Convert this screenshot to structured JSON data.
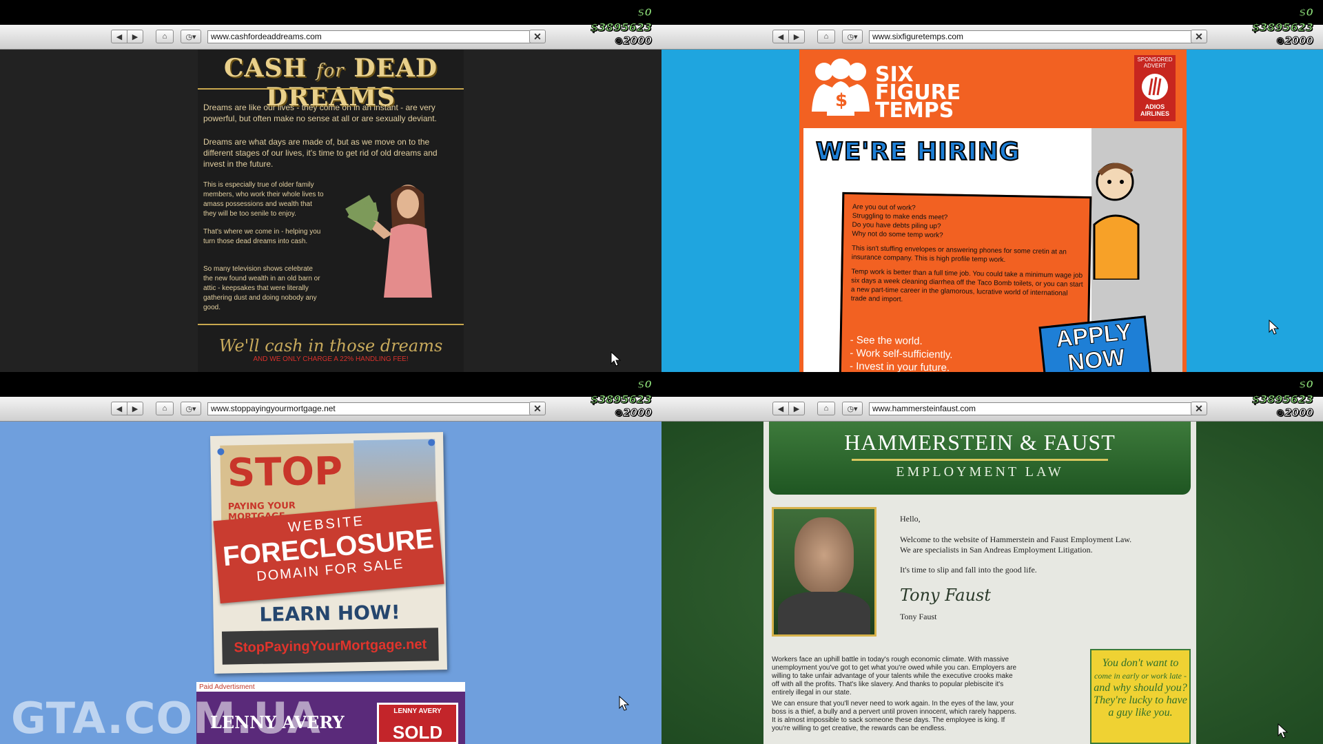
{
  "hud": {
    "cash": "$0",
    "bank": "$3895623",
    "rp": "2000"
  },
  "icons": {
    "back": "back-arrow-icon",
    "forward": "forward-arrow-icon",
    "home": "home-icon",
    "history": "history-clock-icon",
    "close": "close-icon",
    "cursor": "mouse-cursor-icon"
  },
  "toolbar": {
    "back": "◀",
    "forward": "▶",
    "home": "⌂",
    "history": "◷▾",
    "close": "✕"
  },
  "watermark": "GTA.COM.UA",
  "q1": {
    "url": "www.cashfordeaddreams.com",
    "logo_a": "CASH",
    "logo_for": "for",
    "logo_b": "DEAD DREAMS",
    "p1": "Dreams are like our lives - they come on in an instant - are very powerful, but often make no sense at all or are sexually deviant.",
    "p2": "Dreams are what days are made of, but as we move on to the different stages of our lives, it's time to get rid of old dreams and invest in the future.",
    "s1": "This is especially true of older family members, who work their whole lives to amass possessions and wealth that they will be too senile to enjoy.",
    "s2": "That's where we come in - helping you turn those dead dreams into cash.",
    "s3": "So many television shows celebrate the new found wealth in an old barn or attic - keepsakes that were literally gathering dust and doing nobody any good.",
    "slogan": "We'll cash in those dreams",
    "fee": "AND WE ONLY CHARGE A 22% HANDLING FEE!"
  },
  "q2": {
    "url": "www.sixfiguretemps.com",
    "logo": "SIX FIGURE TEMPS",
    "ad_label": "SPONSORED ADVERT",
    "ad_brand": "ADIOS AIRLINES",
    "hiring": "WE'RE HIRING",
    "t1": "Are you out of work?",
    "t2": "Struggling to make ends meet?",
    "t3": "Do you have debts piling up?",
    "t4": "Why not do some temp work?",
    "t5": "This isn't stuffing envelopes or answering phones for some cretin at an insurance company. This is high profile temp work.",
    "t6": "Temp work is better than a full time job. You could take a minimum wage job six days a week cleaning diarrhea off the Taco Bomb toilets, or you can start a new part-time career in the glamorous, lucrative world of international trade and import.",
    "b1": "- See the world.",
    "b2": "- Work self-sufficiently.",
    "b3": "- Invest in your future.",
    "apply": "APPLY NOW"
  },
  "q3": {
    "url": "www.stoppayingyourmortgage.net",
    "stop": "STOP",
    "stop_sub": "PAYING YOUR MORTGAGE",
    "banner1": "WEBSITE",
    "banner2": "FORECLOSURE",
    "banner3": "DOMAIN FOR SALE",
    "learn": "LEARN HOW!",
    "site": "StopPayingYourMortgage.net",
    "ad_label": "Paid Advertisment",
    "ad_name": "LENNY AVERY",
    "ad_sign": "LENNY AVERY",
    "ad_sold": "SOLD"
  },
  "q4": {
    "url": "www.hammersteinfaust.com",
    "title": "HAMMERSTEIN & FAUST",
    "subtitle": "EMPLOYMENT LAW",
    "hello": "Hello,",
    "w1": "Welcome to the website of Hammerstein and Faust Employment Law.",
    "w2": "We are specialists in San Andreas Employment Litigation.",
    "w3": "It's time to slip and fall into the good life.",
    "signature": "Tony Faust",
    "name": "Tony Faust",
    "l1": "Workers face an uphill battle in today's rough economic climate. With massive unemployment you've got to get what you're owed while you can. Employers are willing to take unfair advantage of your talents while the executive crooks make off with all the profits. That's like slavery. And thanks to popular plebiscite it's entirely illegal in our state.",
    "l2": "We can ensure that you'll never need to work again. In the eyes of the law, your boss is a thief, a bully and a pervert until proven innocent, which rarely happens. It is almost impossible to sack someone these days. The employee is king. If you're willing to get creative, the rewards can be endless.",
    "y1": "You don't want to",
    "y2": "come in early or work late -",
    "y3": "and why should you?",
    "y4": "They're lucky to have",
    "y5": "a guy like you."
  }
}
